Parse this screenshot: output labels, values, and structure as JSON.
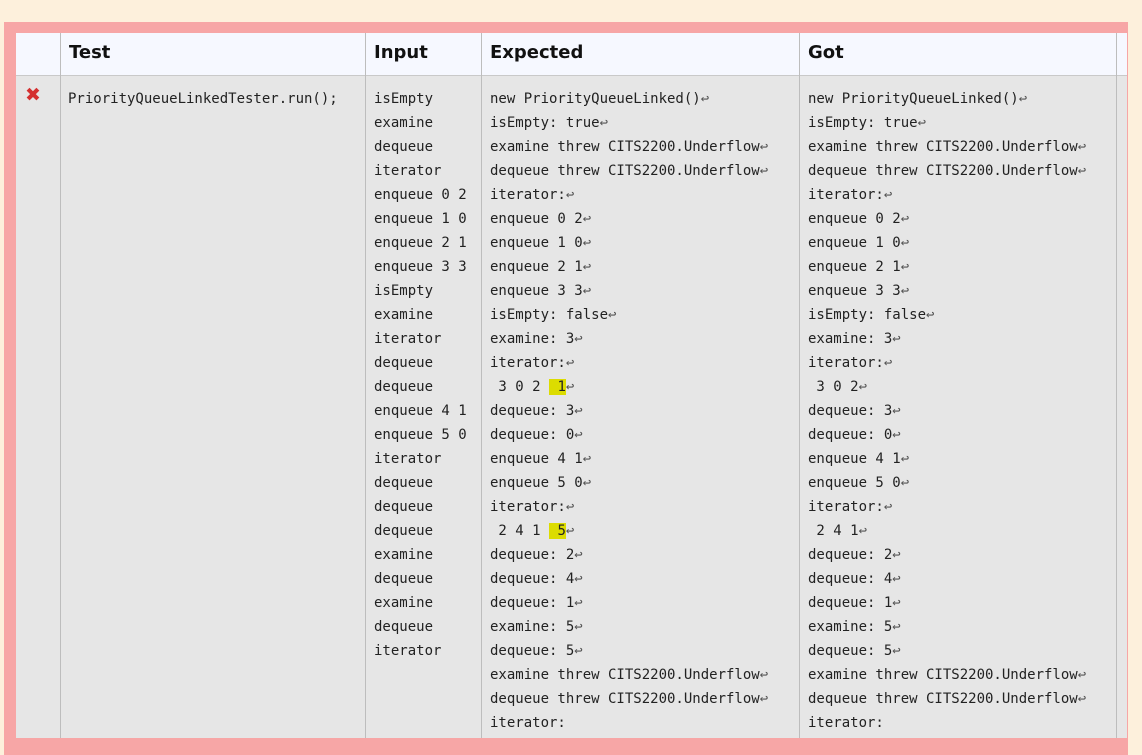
{
  "headers": {
    "test": "Test",
    "input": "Input",
    "expected": "Expected",
    "got": "Got"
  },
  "row": {
    "status_icon": "x-mark-icon",
    "test": "PriorityQueueLinkedTester.run();",
    "input": [
      "isEmpty",
      "examine",
      "dequeue",
      "iterator",
      "enqueue 0 2",
      "enqueue 1 0",
      "enqueue 2 1",
      "enqueue 3 3",
      "isEmpty",
      "examine",
      "iterator",
      "dequeue",
      "dequeue",
      "enqueue 4 1",
      "enqueue 5 0",
      "iterator",
      "dequeue",
      "dequeue",
      "dequeue",
      "examine",
      "dequeue",
      "examine",
      "dequeue",
      "iterator"
    ],
    "expected": [
      {
        "text": "new PriorityQueueLinked()",
        "nl": true
      },
      {
        "text": "isEmpty: true",
        "nl": true
      },
      {
        "text": "examine threw CITS2200.Underflow",
        "nl": true
      },
      {
        "text": "dequeue threw CITS2200.Underflow",
        "nl": true
      },
      {
        "text": "iterator:",
        "nl": true
      },
      {
        "text": "enqueue 0 2",
        "nl": true
      },
      {
        "text": "enqueue 1 0",
        "nl": true
      },
      {
        "text": "enqueue 2 1",
        "nl": true
      },
      {
        "text": "enqueue 3 3",
        "nl": true
      },
      {
        "text": "isEmpty: false",
        "nl": true
      },
      {
        "text": "examine: 3",
        "nl": true
      },
      {
        "text": "iterator:",
        "nl": true
      },
      {
        "text": " 3 0 2 ",
        "hl": " 1",
        "nl": true
      },
      {
        "text": "dequeue: 3",
        "nl": true
      },
      {
        "text": "dequeue: 0",
        "nl": true
      },
      {
        "text": "enqueue 4 1",
        "nl": true
      },
      {
        "text": "enqueue 5 0",
        "nl": true
      },
      {
        "text": "iterator:",
        "nl": true
      },
      {
        "text": " 2 4 1 ",
        "hl": " 5",
        "nl": true
      },
      {
        "text": "dequeue: 2",
        "nl": true
      },
      {
        "text": "dequeue: 4",
        "nl": true
      },
      {
        "text": "dequeue: 1",
        "nl": true
      },
      {
        "text": "examine: 5",
        "nl": true
      },
      {
        "text": "dequeue: 5",
        "nl": true
      },
      {
        "text": "examine threw CITS2200.Underflow",
        "nl": true
      },
      {
        "text": "dequeue threw CITS2200.Underflow",
        "nl": true
      },
      {
        "text": "iterator:",
        "nl": false
      }
    ],
    "got": [
      {
        "text": "new PriorityQueueLinked()",
        "nl": true
      },
      {
        "text": "isEmpty: true",
        "nl": true
      },
      {
        "text": "examine threw CITS2200.Underflow",
        "nl": true
      },
      {
        "text": "dequeue threw CITS2200.Underflow",
        "nl": true
      },
      {
        "text": "iterator:",
        "nl": true
      },
      {
        "text": "enqueue 0 2",
        "nl": true
      },
      {
        "text": "enqueue 1 0",
        "nl": true
      },
      {
        "text": "enqueue 2 1",
        "nl": true
      },
      {
        "text": "enqueue 3 3",
        "nl": true
      },
      {
        "text": "isEmpty: false",
        "nl": true
      },
      {
        "text": "examine: 3",
        "nl": true
      },
      {
        "text": "iterator:",
        "nl": true
      },
      {
        "text": " 3 0 2",
        "nl": true
      },
      {
        "text": "dequeue: 3",
        "nl": true
      },
      {
        "text": "dequeue: 0",
        "nl": true
      },
      {
        "text": "enqueue 4 1",
        "nl": true
      },
      {
        "text": "enqueue 5 0",
        "nl": true
      },
      {
        "text": "iterator:",
        "nl": true
      },
      {
        "text": " 2 4 1",
        "nl": true
      },
      {
        "text": "dequeue: 2",
        "nl": true
      },
      {
        "text": "dequeue: 4",
        "nl": true
      },
      {
        "text": "dequeue: 1",
        "nl": true
      },
      {
        "text": "examine: 5",
        "nl": true
      },
      {
        "text": "dequeue: 5",
        "nl": true
      },
      {
        "text": "examine threw CITS2200.Underflow",
        "nl": true
      },
      {
        "text": "dequeue threw CITS2200.Underflow",
        "nl": true
      },
      {
        "text": "iterator:",
        "nl": false
      }
    ],
    "newline_glyph": "↩"
  },
  "colors": {
    "fail_border": "#f7a6a6",
    "cell_bg": "#e6e6e6",
    "header_bg": "#f6f8ff",
    "diff_highlight": "#dcdc00",
    "fail_icon": "#d43030"
  }
}
